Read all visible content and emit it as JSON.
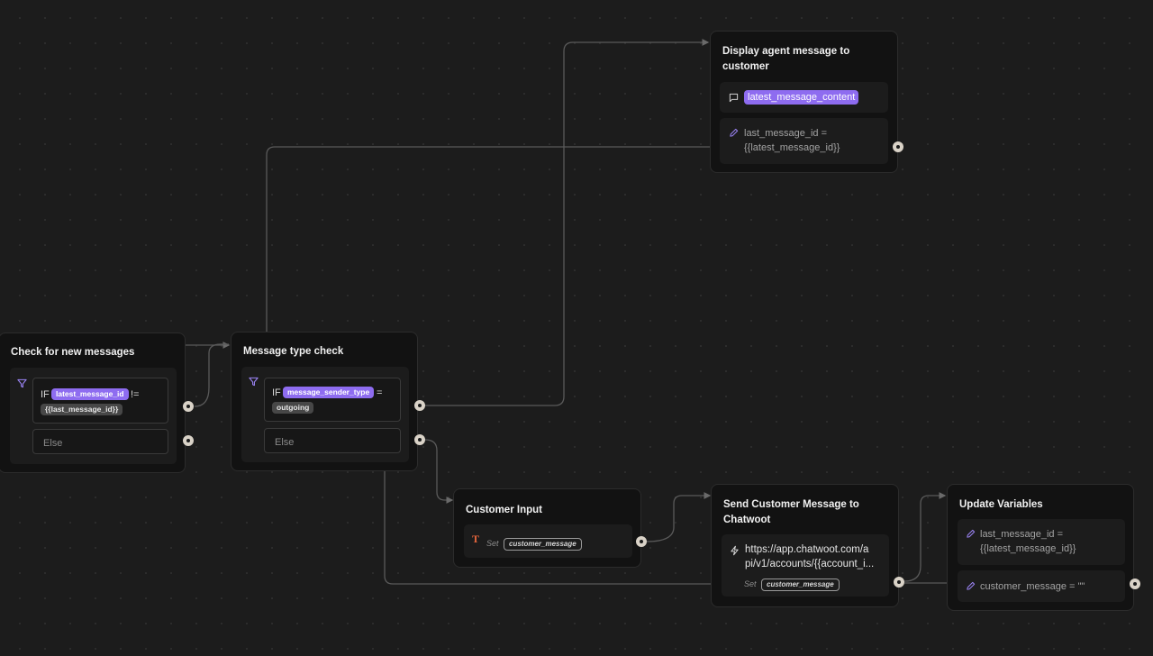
{
  "colors": {
    "canvas": "#1c1c1c",
    "node": "#121212",
    "variable_chip": "#8e6cf0",
    "edge": "#5a5a5a",
    "text_icon_accent": "#e8663d"
  },
  "nodes": {
    "check_new": {
      "title": "Check for new messages",
      "if_keyword": "IF",
      "condition_var": "latest_message_id",
      "operator": "!=",
      "condition_value": "{{last_message_id}}",
      "else_label": "Else",
      "icon": "filter-icon"
    },
    "type_check": {
      "title": "Message type check",
      "if_keyword": "IF",
      "condition_var": "message_sender_type",
      "operator": "=",
      "condition_value": "outgoing",
      "else_label": "Else",
      "icon": "filter-icon"
    },
    "display_agent": {
      "title": "Display agent message to customer",
      "message_var": "latest_message_content",
      "message_icon": "chat-bubble-icon",
      "set_line1": "last_message_id =",
      "set_line2": "{{latest_message_id}}",
      "set_icon": "pencil-icon"
    },
    "customer_input": {
      "title": "Customer Input",
      "input_icon": "text-input-icon",
      "set_label": "Set",
      "set_var": "customer_message"
    },
    "send_chatwoot": {
      "title": "Send Customer Message to Chatwoot",
      "api_icon": "lightning-icon",
      "url_line1": "https://app.chatwoot.com/a",
      "url_line2": "pi/v1/accounts/{{account_i...",
      "set_label": "Set",
      "set_var": "customer_message"
    },
    "update_vars": {
      "title": "Update Variables",
      "item1_line1": "last_message_id =",
      "item1_line2": "{{latest_message_id}}",
      "item2": "customer_message = \"\"",
      "set_icon": "pencil-icon"
    }
  }
}
